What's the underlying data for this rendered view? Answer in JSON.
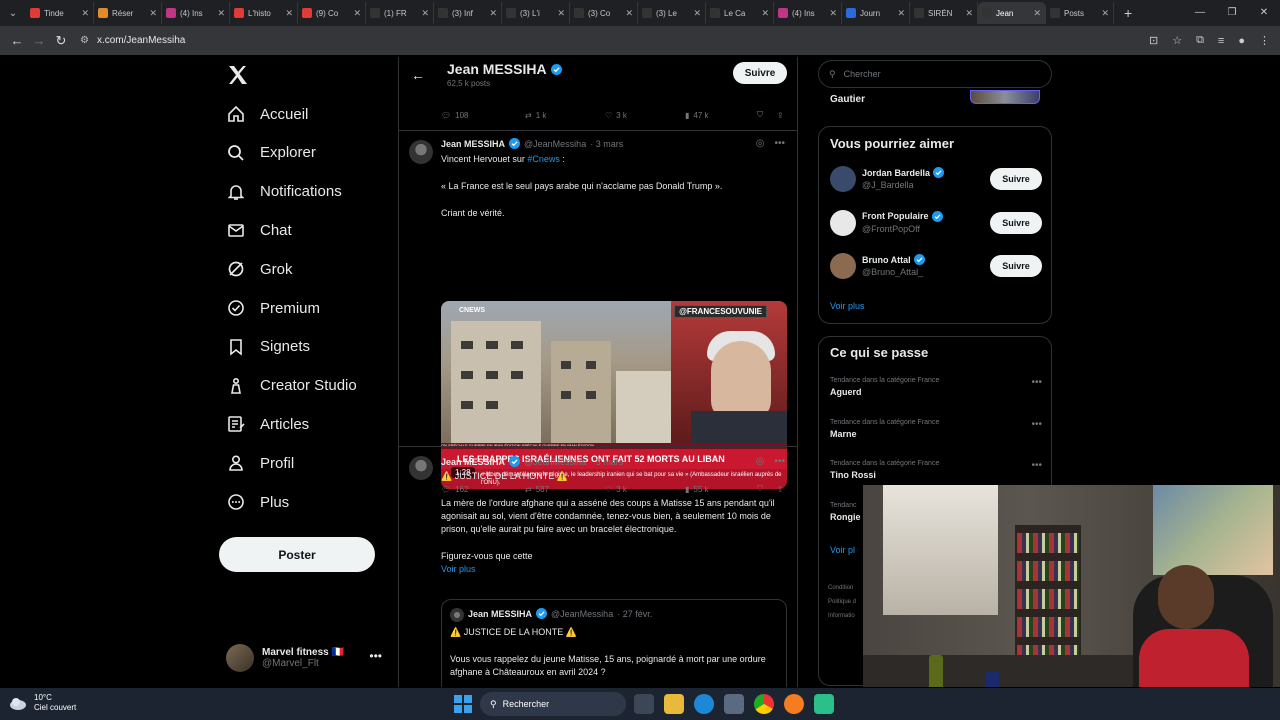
{
  "browser": {
    "tabs": [
      {
        "label": "Tinde",
        "color": "#e03b3b",
        "icon": "youtube-icon"
      },
      {
        "label": "Réser",
        "color": "#e38a2a",
        "icon": "site-icon"
      },
      {
        "label": "(4) Ins",
        "color": "#c13584",
        "icon": "instagram-icon"
      },
      {
        "label": "L'histo",
        "color": "#e03b3b",
        "icon": "youtube-icon"
      },
      {
        "label": "(9) Co",
        "color": "#e03b3b",
        "icon": "youtube-icon"
      },
      {
        "label": "(1) FR",
        "color": "#333333",
        "icon": "x-icon"
      },
      {
        "label": "(3) Inf",
        "color": "#333333",
        "icon": "x-icon"
      },
      {
        "label": "(3) L'i",
        "color": "#333333",
        "icon": "x-icon"
      },
      {
        "label": "(3) Co",
        "color": "#333333",
        "icon": "x-icon"
      },
      {
        "label": "(3) Le",
        "color": "#333333",
        "icon": "x-icon"
      },
      {
        "label": "Le Ca",
        "color": "#333333",
        "icon": "x-icon"
      },
      {
        "label": "(4) Ins",
        "color": "#c13584",
        "icon": "instagram-icon"
      },
      {
        "label": "Journ",
        "color": "#2a6adb",
        "icon": "site-icon"
      },
      {
        "label": "SIRÈN",
        "color": "#333333",
        "icon": "x-icon"
      },
      {
        "label": "Jean",
        "color": "#333333",
        "icon": "x-icon",
        "active": true
      },
      {
        "label": "Posts",
        "color": "#333333",
        "icon": "x-icon"
      }
    ],
    "url": "x.com/JeanMessiha"
  },
  "nav": {
    "items": [
      {
        "label": "Accueil",
        "icon": "home-icon"
      },
      {
        "label": "Explorer",
        "icon": "search-icon"
      },
      {
        "label": "Notifications",
        "icon": "bell-icon"
      },
      {
        "label": "Chat",
        "icon": "mail-icon"
      },
      {
        "label": "Grok",
        "icon": "grok-icon"
      },
      {
        "label": "Premium",
        "icon": "premium-icon"
      },
      {
        "label": "Signets",
        "icon": "bookmark-icon"
      },
      {
        "label": "Creator Studio",
        "icon": "creator-icon"
      },
      {
        "label": "Articles",
        "icon": "article-icon"
      },
      {
        "label": "Profil",
        "icon": "person-icon"
      },
      {
        "label": "Plus",
        "icon": "more-circle-icon"
      }
    ],
    "post_button": "Poster",
    "account": {
      "name": "Marvel fitness 🇫🇷",
      "handle": "@Marvel_Flt"
    }
  },
  "profile_header": {
    "name": "Jean MESSIHA",
    "posts": "62,5 k posts",
    "follow": "Suivre"
  },
  "top_actions": {
    "reply": "108",
    "repost": "1 k",
    "like": "3 k",
    "views": "47 k"
  },
  "tweet1": {
    "name": "Jean MESSIHA",
    "handle": "@JeanMessiha",
    "date": "· 3 mars",
    "line1_prefix": "Vincent Hervouet sur ",
    "line1_hashtag": "#Cnews",
    "line1_suffix": " :",
    "line2": "« La France est le seul pays arabe qui n'acclame pas Donald Trump ».",
    "line3": "Criant de vérité.",
    "media": {
      "tag": "@FRANCESOUVUNIE",
      "logo": "CNEWS",
      "strip": "ON SPÉCIALE     GUERRE EN IRAN     ÉDITION SPÉCIALE     GUERRE EN IRAN     ÉDITION",
      "banner": "LES FRAPPES ISRAÉLIENNES ONT FAIT 52 MORTS AU LIBAN",
      "sub": "« Nous démantèlerons le régime, le leadership iranien qui se bat pour sa vie » (Ambassadeur israélien auprès de l'ONU).",
      "duration": "1:28"
    },
    "actions": {
      "reply": "162",
      "repost": "587",
      "like": "3 k",
      "views": "55 k"
    }
  },
  "tweet2": {
    "name": "Jean MESSIHA",
    "handle": "@JeanMessiha",
    "date": "· 3 mars",
    "title": "⚠️ JUSTICE DE LA HONTE ⚠️",
    "body": "La mère de l'ordure afghane qui a asséné des coups à Matisse 15 ans pendant qu'il agonisait au sol, vient d'être condamnée, tenez-vous bien, à seulement 10 mois de prison, qu'elle aurait pu faire avec un bracelet électronique.",
    "tail": "Figurez-vous que cette",
    "show_more": "Voir plus",
    "quote": {
      "name": "Jean MESSIHA",
      "handle": "@JeanMessiha",
      "date": "· 27 févr.",
      "title": "⚠️ JUSTICE DE LA HONTE ⚠️",
      "body": "Vous vous rappelez du jeune Matisse, 15 ans, poignardé à mort par une ordure afghane à Châteauroux en avril 2024 ?"
    }
  },
  "sidebar": {
    "search_placeholder": "Chercher",
    "gautier": "Gautier",
    "suggestions_title": "Vous pourriez aimer",
    "suggestions": [
      {
        "name": "Jordan Bardella",
        "handle": "@J_Bardella",
        "button": "Suivre",
        "color": "#3a4a6a"
      },
      {
        "name": "Front Populaire",
        "handle": "@FrontPopOff",
        "button": "Suivre",
        "color": "#e8e8e8"
      },
      {
        "name": "Bruno Attal",
        "handle": "@Bruno_Attal_",
        "button": "Suivre",
        "color": "#8a6a50"
      }
    ],
    "see_more": "Voir plus",
    "trends_title": "Ce qui se passe",
    "trends": [
      {
        "category": "Tendance dans la catégorie France",
        "name": "Aguerd"
      },
      {
        "category": "Tendance dans la catégorie France",
        "name": "Marne"
      },
      {
        "category": "Tendance dans la catégorie France",
        "name": "Tino Rossi"
      },
      {
        "category": "Tendanc",
        "name": "Rongie"
      }
    ],
    "see_more2": "Voir pl",
    "footer": [
      "Condition",
      "Politique d",
      "Informatio"
    ]
  },
  "taskbar": {
    "temp": "10°C",
    "condition": "Ciel couvert",
    "search": "Rechercher"
  }
}
